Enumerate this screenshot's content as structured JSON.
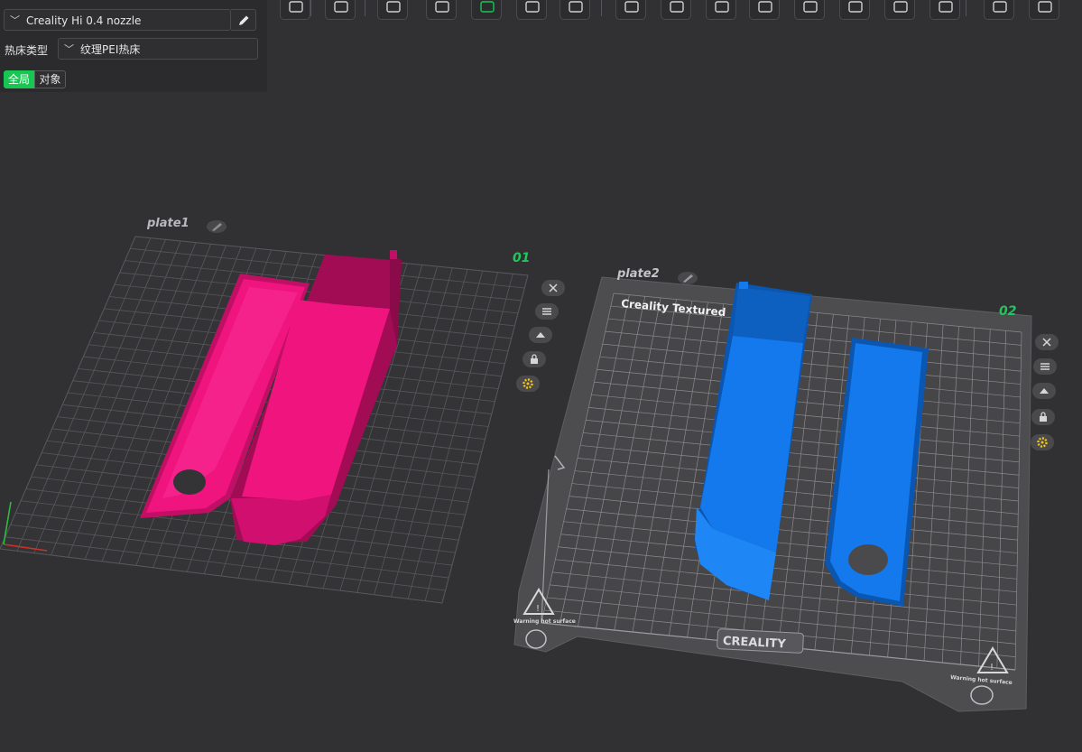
{
  "panel": {
    "printer": {
      "value": "Creality Hi 0.4 nozzle"
    },
    "bed_type": {
      "label": "热床类型",
      "value": "纹理PEI热床"
    },
    "scope_tabs": [
      {
        "label": "全局",
        "active": true
      },
      {
        "label": "对象",
        "active": false
      }
    ]
  },
  "toolbar": {
    "buttons": [
      "add-cube-icon",
      "grid-icon",
      "auto-orient-icon",
      "rotate-icon",
      "paint-icon",
      "arrange-icon",
      "lay-on-face-icon",
      "split-objects-icon",
      "split-parts-icon",
      "cut-icon",
      "layer-icon",
      "seam-icon",
      "support-paint-icon",
      "boolean-icon",
      "measure-icon",
      "assemble-icon",
      "text-icon"
    ]
  },
  "plates": [
    {
      "name": "plate1",
      "number": "01",
      "model_color": "#f0147e",
      "model_shade": "#c20f66"
    },
    {
      "name": "plate2",
      "number": "02",
      "bed_title": "Creality Textured",
      "bed_brand": "CREALITY",
      "warning": "Warning hot surface",
      "model_color": "#1479ec",
      "model_shade": "#0a56b0"
    }
  ],
  "colors": {
    "background": "#313133",
    "accent": "#17c653",
    "plate_number": "#22c55e",
    "grid": "#5d5d61",
    "bed": "#4d4d50"
  }
}
